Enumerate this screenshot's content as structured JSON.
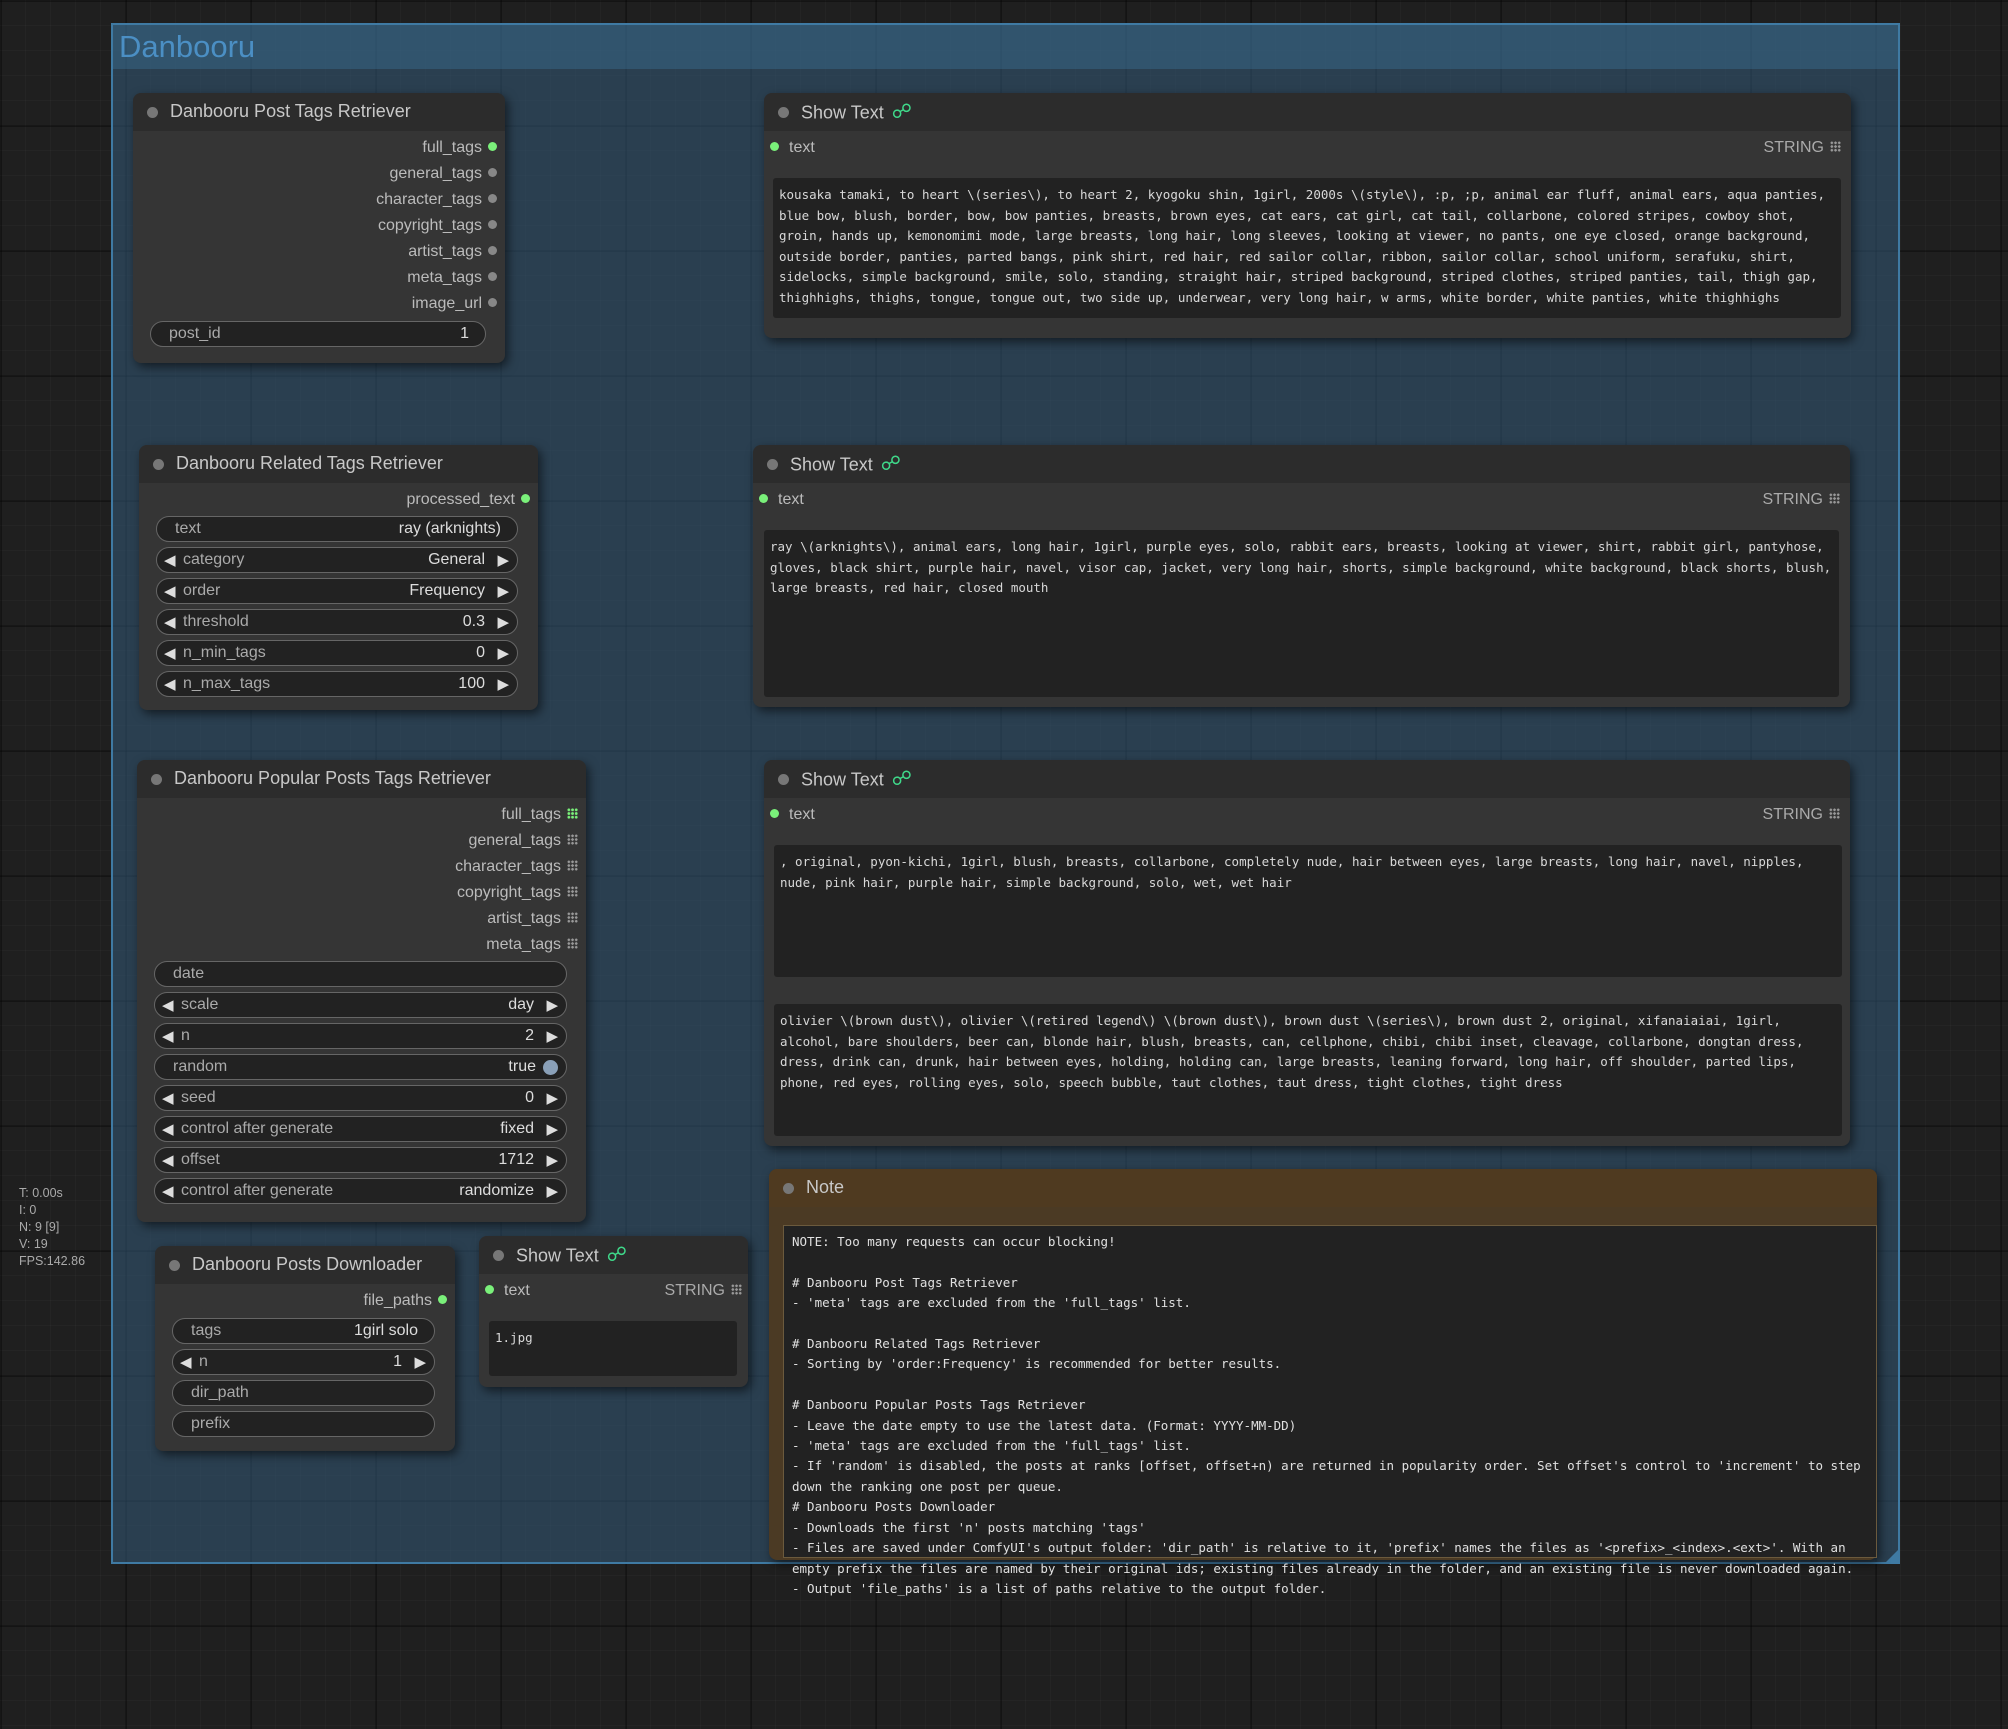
{
  "group": {
    "title": "Danbooru"
  },
  "post_tags": {
    "title": "Danbooru Post Tags Retriever",
    "outputs": [
      "full_tags",
      "general_tags",
      "character_tags",
      "copyright_tags",
      "artist_tags",
      "meta_tags",
      "image_url"
    ],
    "post_id_label": "post_id",
    "post_id_value": "1"
  },
  "related_tags": {
    "title": "Danbooru Related Tags Retriever",
    "output": "processed_text",
    "widgets": [
      {
        "label": "text",
        "value": "ray (arknights)"
      },
      {
        "label": "category",
        "value": "General"
      },
      {
        "label": "order",
        "value": "Frequency"
      },
      {
        "label": "threshold",
        "value": "0.3"
      },
      {
        "label": "n_min_tags",
        "value": "0"
      },
      {
        "label": "n_max_tags",
        "value": "100"
      }
    ]
  },
  "popular_posts": {
    "title": "Danbooru Popular Posts Tags Retriever",
    "outputs": [
      "full_tags",
      "general_tags",
      "character_tags",
      "copyright_tags",
      "artist_tags",
      "meta_tags"
    ],
    "widgets": [
      {
        "label": "date",
        "value": ""
      },
      {
        "label": "scale",
        "value": "day"
      },
      {
        "label": "n",
        "value": "2"
      },
      {
        "label": "random",
        "value": "true"
      },
      {
        "label": "seed",
        "value": "0"
      },
      {
        "label": "control after generate",
        "value": "fixed"
      },
      {
        "label": "offset",
        "value": "1712"
      },
      {
        "label": "control after generate",
        "value": "randomize"
      }
    ]
  },
  "downloader": {
    "title": "Danbooru Posts Downloader",
    "output": "file_paths",
    "widgets": [
      {
        "label": "tags",
        "value": "1girl solo"
      },
      {
        "label": "n",
        "value": "1"
      },
      {
        "label": "dir_path",
        "value": ""
      },
      {
        "label": "prefix",
        "value": ""
      }
    ]
  },
  "show_text": {
    "title": "Show Text",
    "input_label": "text",
    "type_label": "STRING",
    "text1": "kousaka tamaki, to heart \\(series\\), to heart 2, kyogoku shin, 1girl, 2000s \\(style\\), :p, ;p, animal ear fluff, animal ears, aqua panties, blue bow, blush, border, bow, bow panties, breasts, brown eyes, cat ears, cat girl, cat tail, collarbone, colored stripes, cowboy shot, groin, hands up, kemonomimi mode, large breasts, long hair, long sleeves, looking at viewer, no pants, one eye closed, orange background, outside border, panties, parted bangs, pink shirt, red hair, red sailor collar, ribbon, sailor collar, school uniform, serafuku, shirt, sidelocks, simple background, smile, solo, standing, straight hair, striped background, striped clothes, striped panties, tail, thigh gap, thighhighs, thighs, tongue, tongue out, two side up, underwear, very long hair, w arms, white border, white panties, white thighhighs",
    "text2": "ray \\(arknights\\), animal ears, long hair, 1girl, purple eyes, solo, rabbit ears, breasts, looking at viewer, shirt, rabbit girl, pantyhose, gloves, black shirt, purple hair, navel, visor cap, jacket, very long hair, shorts, simple background, white background, black shorts, blush, large breasts, red hair, closed mouth",
    "text3a": ", original, pyon-kichi, 1girl, blush, breasts, collarbone, completely nude, hair between eyes, large breasts, long hair, navel, nipples, nude, pink hair, purple hair, simple background, solo, wet, wet hair",
    "text3b": "olivier \\(brown dust\\), olivier \\(retired legend\\) \\(brown dust\\), brown dust \\(series\\), brown dust 2, original, xifanaiaiai, 1girl, alcohol, bare shoulders, beer can, blonde hair, blush, breasts, can, cellphone, chibi, chibi inset, cleavage, collarbone, dongtan dress, dress, drink can, drunk, hair between eyes, holding, holding can, large breasts, leaning forward, long hair, off shoulder, parted lips, phone, red eyes, rolling eyes, solo, speech bubble, taut clothes, taut dress, tight clothes, tight dress",
    "text4": "1.jpg"
  },
  "note": {
    "title": "Note",
    "text": "NOTE: Too many requests can occur blocking!\n\n# Danbooru Post Tags Retriever\n- 'meta' tags are excluded from the 'full_tags' list.\n\n# Danbooru Related Tags Retriever\n- Sorting by 'order:Frequency' is recommended for better results.\n\n# Danbooru Popular Posts Tags Retriever\n- Leave the date empty to use the latest data. (Format: YYYY-MM-DD)\n- 'meta' tags are excluded from the 'full_tags' list.\n- If 'random' is disabled, the posts at ranks [offset, offset+n) are returned in popularity order. Set offset's control to 'increment' to step down the ranking one post per queue.\n# Danbooru Posts Downloader\n- Downloads the first 'n' posts matching 'tags'\n- Files are saved under ComfyUI's output folder: 'dir_path' is relative to it, 'prefix' names the files as '<prefix>_<index>.<ext>'. With an empty prefix the files are named by their original ids; existing files already in the folder, and an existing file is never downloaded again.\n- Output 'file_paths' is a list of paths relative to the output folder."
  },
  "stats": "T: 0.00s\nI: 0\nN: 9 [9]\nV: 19\nFPS:142.86",
  "colors": {
    "group": "#335978",
    "connected_slot": "#7af07a",
    "note_bg": "#4b3a24",
    "link_icon": "#3fd98a"
  }
}
